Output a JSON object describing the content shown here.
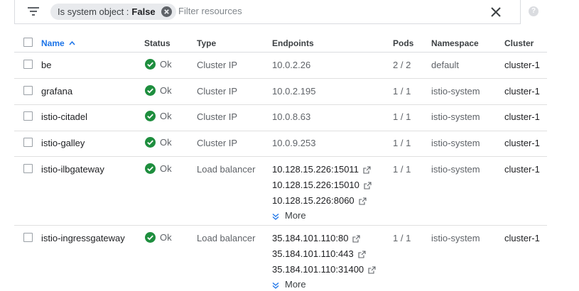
{
  "filter": {
    "chip_key": "Is system object :",
    "chip_value": "False",
    "placeholder": "Filter resources"
  },
  "columns": {
    "name": "Name",
    "status": "Status",
    "type": "Type",
    "endpoints": "Endpoints",
    "pods": "Pods",
    "namespace": "Namespace",
    "cluster": "Cluster"
  },
  "more_label": "More",
  "rows": [
    {
      "name": "be",
      "status": "Ok",
      "type": "Cluster IP",
      "endpoints": [
        "10.0.2.26"
      ],
      "pods": "2 / 2",
      "namespace": "default",
      "cluster": "cluster-1"
    },
    {
      "name": "grafana",
      "status": "Ok",
      "type": "Cluster IP",
      "endpoints": [
        "10.0.2.195"
      ],
      "pods": "1 / 1",
      "namespace": "istio-system",
      "cluster": "cluster-1"
    },
    {
      "name": "istio-citadel",
      "status": "Ok",
      "type": "Cluster IP",
      "endpoints": [
        "10.0.8.63"
      ],
      "pods": "1 / 1",
      "namespace": "istio-system",
      "cluster": "cluster-1"
    },
    {
      "name": "istio-galley",
      "status": "Ok",
      "type": "Cluster IP",
      "endpoints": [
        "10.0.9.253"
      ],
      "pods": "1 / 1",
      "namespace": "istio-system",
      "cluster": "cluster-1"
    },
    {
      "name": "istio-ilbgateway",
      "status": "Ok",
      "type": "Load balancer",
      "endpoints": [
        "10.128.15.226:15011",
        "10.128.15.226:15010",
        "10.128.15.226:8060"
      ],
      "pods": "1 / 1",
      "namespace": "istio-system",
      "cluster": "cluster-1"
    },
    {
      "name": "istio-ingressgateway",
      "status": "Ok",
      "type": "Load balancer",
      "endpoints": [
        "35.184.101.110:80",
        "35.184.101.110:443",
        "35.184.101.110:31400"
      ],
      "pods": "1 / 1",
      "namespace": "istio-system",
      "cluster": "cluster-1"
    }
  ],
  "colors": {
    "accent": "#1a73e8",
    "ok": "#1e8e3e"
  }
}
